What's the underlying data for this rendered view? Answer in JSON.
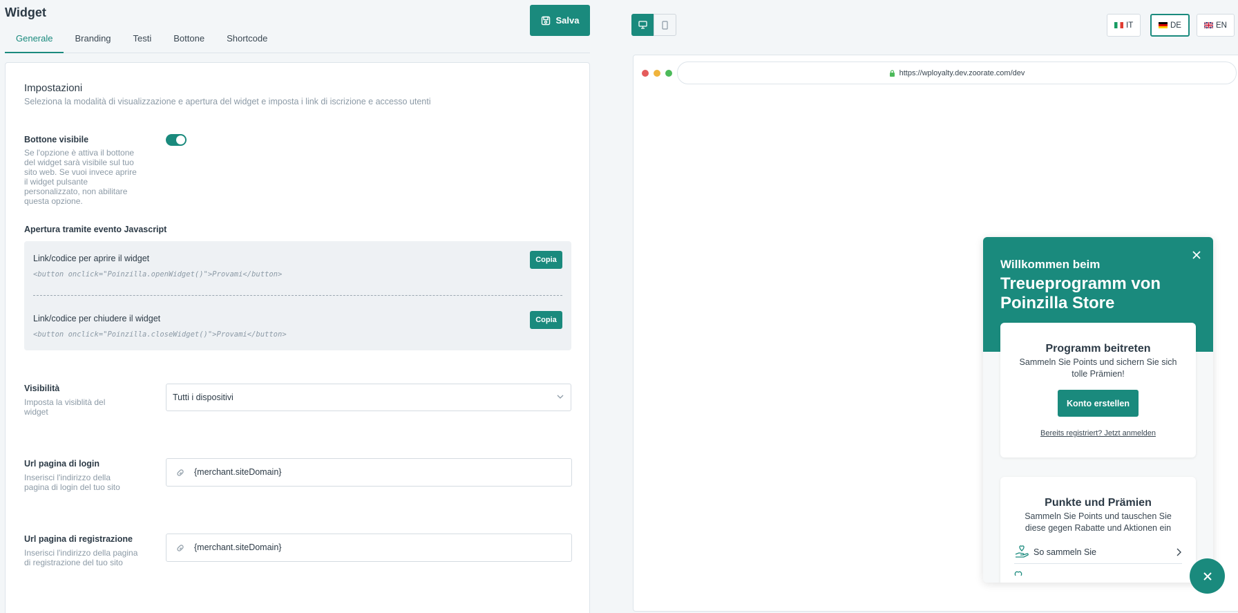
{
  "header": {
    "title": "Widget",
    "save_label": "Salva"
  },
  "tabs": [
    {
      "label": "Generale",
      "active": true
    },
    {
      "label": "Branding",
      "active": false
    },
    {
      "label": "Testi",
      "active": false
    },
    {
      "label": "Bottone",
      "active": false
    },
    {
      "label": "Shortcode",
      "active": false
    }
  ],
  "settings": {
    "title": "Impostazioni",
    "subtitle": "Seleziona la modalità di visualizzazione e apertura del widget e imposta i link di iscrizione e accesso utenti",
    "button_visible": {
      "label": "Bottone visibile",
      "description": "Se l'opzione è attiva il bottone del widget sarà visibile sul tuo sito web. Se vuoi invece aprire il widget pulsante personalizzato, non abilitare questa opzione.",
      "enabled": true
    },
    "js_event": {
      "label": "Apertura tramite evento Javascript",
      "open": {
        "label": "Link/codice per aprire il widget",
        "code": "<button onclick=\"Poinzilla.openWidget()\">Provami</button>",
        "copy_label": "Copia"
      },
      "close": {
        "label": "Link/codice per chiudere il widget",
        "code": "<button onclick=\"Poinzilla.closeWidget()\">Provami</button>",
        "copy_label": "Copia"
      }
    },
    "visibility": {
      "label": "Visibilità",
      "description": "Imposta la visiblità del widget",
      "selected": "Tutti i dispositivi"
    },
    "login_url": {
      "label": "Url pagina di login",
      "description": "Inserisci l'indirizzo della pagina di login del tuo sito",
      "value": "{merchant.siteDomain}"
    },
    "register_url": {
      "label": "Url pagina di registrazione",
      "description": "Inserisci l'indirizzo della pagina di registrazione del tuo sito",
      "value": "{merchant.siteDomain}"
    }
  },
  "preview": {
    "languages": [
      {
        "code": "IT",
        "active": false
      },
      {
        "code": "DE",
        "active": true
      },
      {
        "code": "EN",
        "active": false
      }
    ],
    "url": "https://wployalty.dev.zoorate.com/dev",
    "widget": {
      "welcome": "Willkommen beim",
      "program_title": "Treueprogramm von Poinzilla Store",
      "join": {
        "title": "Programm beitreten",
        "text": "Sammeln Sie Points und sichern Sie sich tolle Prämien!",
        "button": "Konto erstellen",
        "login_link": "Bereits registriert? Jetzt anmelden"
      },
      "points": {
        "title": "Punkte und Prämien",
        "text": "Sammeln Sie Points und tauschen Sie diese gegen Rabatte und Aktionen ein",
        "row1": "So sammeln Sie"
      }
    }
  },
  "colors": {
    "accent": "#1a8a7d"
  }
}
